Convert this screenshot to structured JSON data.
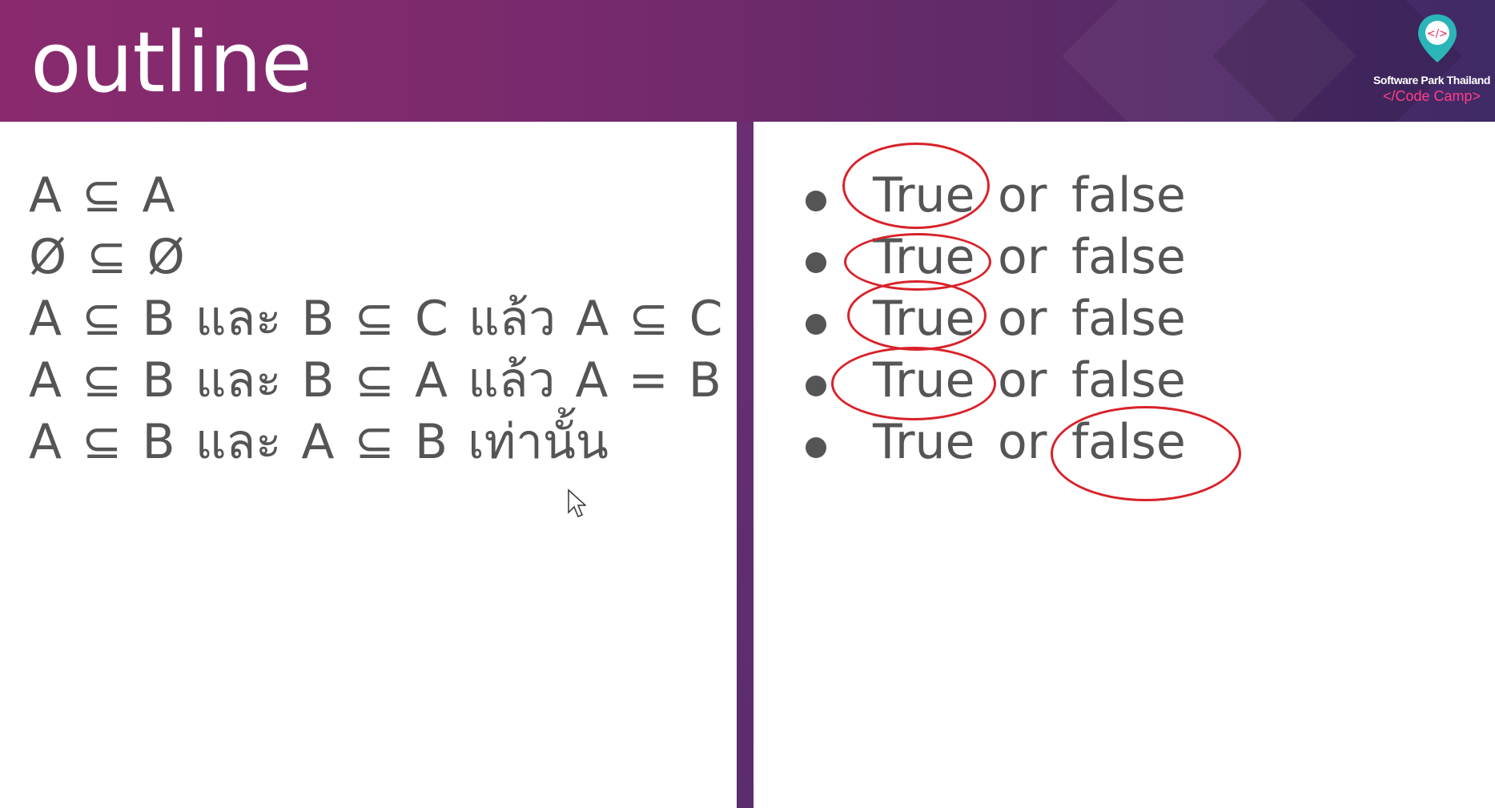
{
  "slide": {
    "title": "outline",
    "logo": {
      "icon": "code-pin-icon",
      "name": "Software Park Thailand",
      "tagline": "</Code Camp>"
    },
    "left_statements": [
      "A ⊆ A",
      "Ø ⊆ Ø",
      "A ⊆ B และ B ⊆ C แล้ว A ⊆ C",
      "A ⊆ B และ B ⊆ A แล้ว A = B",
      "A ⊆ B และ A ⊆ B เท่านั้น"
    ],
    "right_items": [
      {
        "true": "True",
        "or": "or",
        "false": "false",
        "circled": "True"
      },
      {
        "true": "True",
        "or": "or",
        "false": "false",
        "circled": "True"
      },
      {
        "true": "True",
        "or": "or",
        "false": "false",
        "circled": "True"
      },
      {
        "true": "True",
        "or": "or",
        "false": "false",
        "circled": "True"
      },
      {
        "true": "True",
        "or": "or",
        "false": "false",
        "circled": "false"
      }
    ]
  },
  "colors": {
    "header_start": "#8a2a6e",
    "header_end": "#3f2a66",
    "body_text": "#555555",
    "annotation_circle": "#d8222a",
    "tagline": "#ff3d8a"
  }
}
